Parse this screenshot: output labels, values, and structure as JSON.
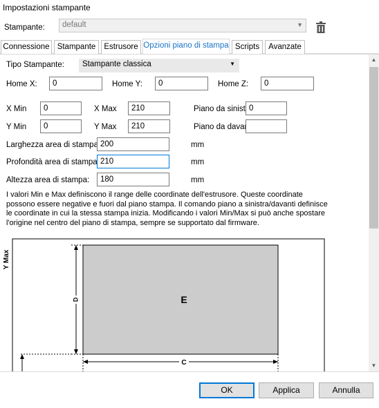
{
  "window": {
    "title": "Impostazioni stampante"
  },
  "printer": {
    "label": "Stampante:",
    "value": "default",
    "delete_icon": "trash-icon"
  },
  "tabs": [
    {
      "label": "Connessione",
      "active": false
    },
    {
      "label": "Stampante",
      "active": false
    },
    {
      "label": "Estrusore",
      "active": false
    },
    {
      "label": "Opzioni piano di stampa",
      "active": true
    },
    {
      "label": "Scripts",
      "active": false
    },
    {
      "label": "Avanzate",
      "active": false
    }
  ],
  "bed": {
    "printer_type": {
      "label": "Tipo Stampante:",
      "value": "Stampante classica"
    },
    "home_x": {
      "label": "Home X:",
      "value": "0"
    },
    "home_y": {
      "label": "Home Y:",
      "value": "0"
    },
    "home_z": {
      "label": "Home Z:",
      "value": "0"
    },
    "x_min": {
      "label": "X Min",
      "value": "0"
    },
    "x_max": {
      "label": "X Max",
      "value": "210"
    },
    "y_min": {
      "label": "Y Min",
      "value": "0"
    },
    "y_max": {
      "label": "Y Max",
      "value": "210"
    },
    "bed_left": {
      "label": "Piano da sinistra:",
      "value": "0"
    },
    "bed_front": {
      "label": "Piano da davanti:",
      "value": ""
    },
    "width": {
      "label": "Larghezza area di stampa:",
      "value": "200",
      "unit": "mm"
    },
    "depth": {
      "label": "Profondità area di stampa:",
      "value": "210",
      "unit": "mm"
    },
    "height": {
      "label": "Altezza area di stampa:",
      "value": "180",
      "unit": "mm"
    },
    "description": "I valori Min e Max definiscono il range delle coordinate dell'estrusore. Queste coordinate possono essere negative e fuori dal piano stampa. Il comando piano a sinistra/davanti definisce le coordinate in cui la stessa stampa inizia. Modificando i valori Min/Max si può anche spostare l'origine nel centro del piano di stampa, sempre se supportato dal firmware."
  },
  "diagram": {
    "y_axis_label": "Y Max",
    "center_label": "E",
    "depth_label": "D",
    "width_label": "C"
  },
  "buttons": {
    "ok": "OK",
    "apply": "Applica",
    "cancel": "Annulla"
  },
  "colors": {
    "accent": "#0078d7",
    "tab_active_text": "#1a73c8",
    "bed_fill": "#cccccc"
  }
}
